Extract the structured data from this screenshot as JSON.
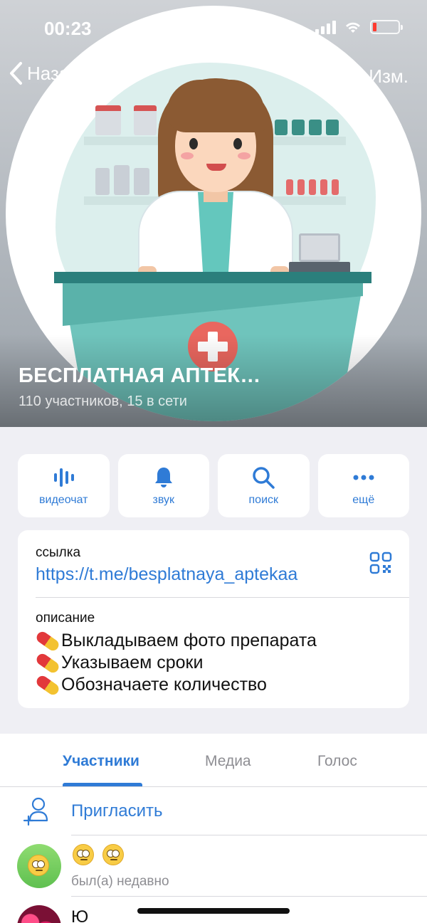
{
  "status_bar": {
    "time": "00:23"
  },
  "nav": {
    "back_label": "Назад",
    "edit_label": "Изм."
  },
  "chat": {
    "title": "БЕСПЛАТНАЯ АПТЕК…",
    "subtitle": "110 участников, 15 в сети"
  },
  "actions": [
    {
      "label": "видеочат",
      "icon": "voice-chat-icon"
    },
    {
      "label": "звук",
      "icon": "bell-icon"
    },
    {
      "label": "поиск",
      "icon": "search-icon"
    },
    {
      "label": "ещё",
      "icon": "more-icon"
    }
  ],
  "info": {
    "link_label": "ссылка",
    "link": "https://t.me/besplatnaya_aptekaa",
    "description_label": "описание",
    "description_lines": [
      "Выкладываем фото препарата",
      "Указываем сроки",
      "Обозначаете количество"
    ]
  },
  "tabs": [
    {
      "label": "Участники",
      "active": true
    },
    {
      "label": "Медиа",
      "active": false
    },
    {
      "label": "Голос",
      "active": false
    }
  ],
  "invite_label": "Пригласить",
  "members": [
    {
      "name": "",
      "status": "был(а) недавно",
      "avatar": "eye-roll-emoji"
    },
    {
      "name": "Ю",
      "status": "",
      "avatar": "flowers-photo"
    }
  ],
  "colors": {
    "accent": "#2f7bd6",
    "background": "#efeff4",
    "battery_low": "#ff3b30"
  }
}
